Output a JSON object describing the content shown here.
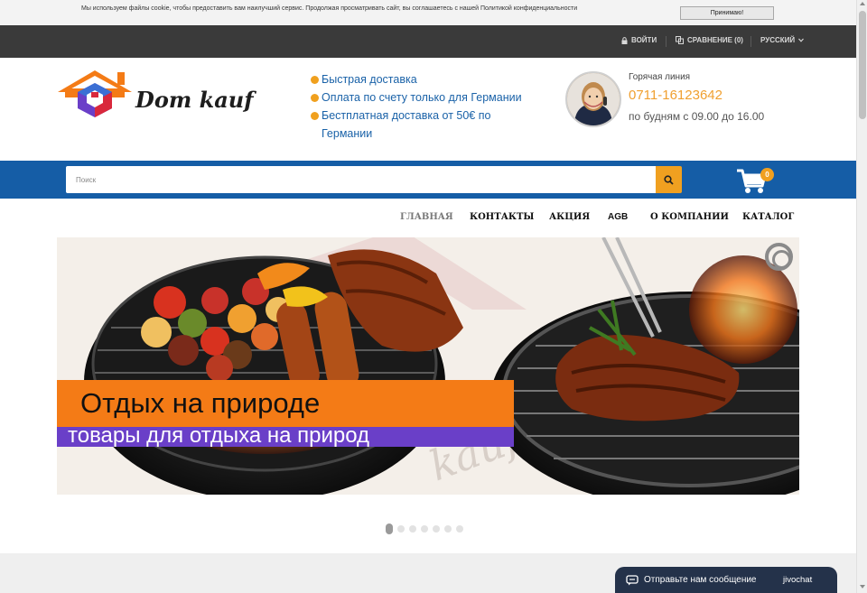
{
  "cookie_bar": {
    "text": "Мы используем файлы cookie, чтобы предоставить вам наилучший сервис. Продолжая просматривать сайт, вы соглашаетесь с нашей Политикой конфиденциальности",
    "accept_label": "Принимаю!"
  },
  "top_bar": {
    "login_label": "ВОЙТИ",
    "compare_label": "СРАВНЕНИЕ (0)",
    "language_label": "РУССКИЙ"
  },
  "header": {
    "logo_text": "Dom kauf",
    "features": [
      "Быстрая доставка",
      "Оплата по счету только для Германии",
      "Бестплатная доставка от 50€ по Германии"
    ],
    "hotline_label": "Горячая линия",
    "hotline_phone": "0711-16123642",
    "hotline_hours": "по будням с 09.00 до 16.00"
  },
  "search": {
    "placeholder": "Поиск",
    "cart_count": "0"
  },
  "nav": {
    "items": [
      "ГЛАВНАЯ",
      "КОНТАКТЫ",
      "АКЦИЯ",
      "AGB",
      "О КОМПАНИИ",
      "КАТАЛОГ"
    ],
    "active_index": 0
  },
  "banner": {
    "title": "Отдых на природе",
    "subtitle": "товары для отдыха на природ",
    "slide_count": 7,
    "active_slide": 1
  },
  "chat": {
    "label": "Отправьте нам сообщение",
    "brand": "jivochat"
  },
  "colors": {
    "brand_blue": "#155da6",
    "accent_orange": "#f0a020",
    "top_bar": "#3a3a3a",
    "banner_orange": "#f47b16",
    "banner_purple": "#6a3fc8"
  },
  "icons": [
    "lock-icon",
    "compare-icon",
    "chevron-down-icon",
    "search-icon",
    "cart-icon",
    "slider-toggle-icon",
    "chat-icon"
  ]
}
